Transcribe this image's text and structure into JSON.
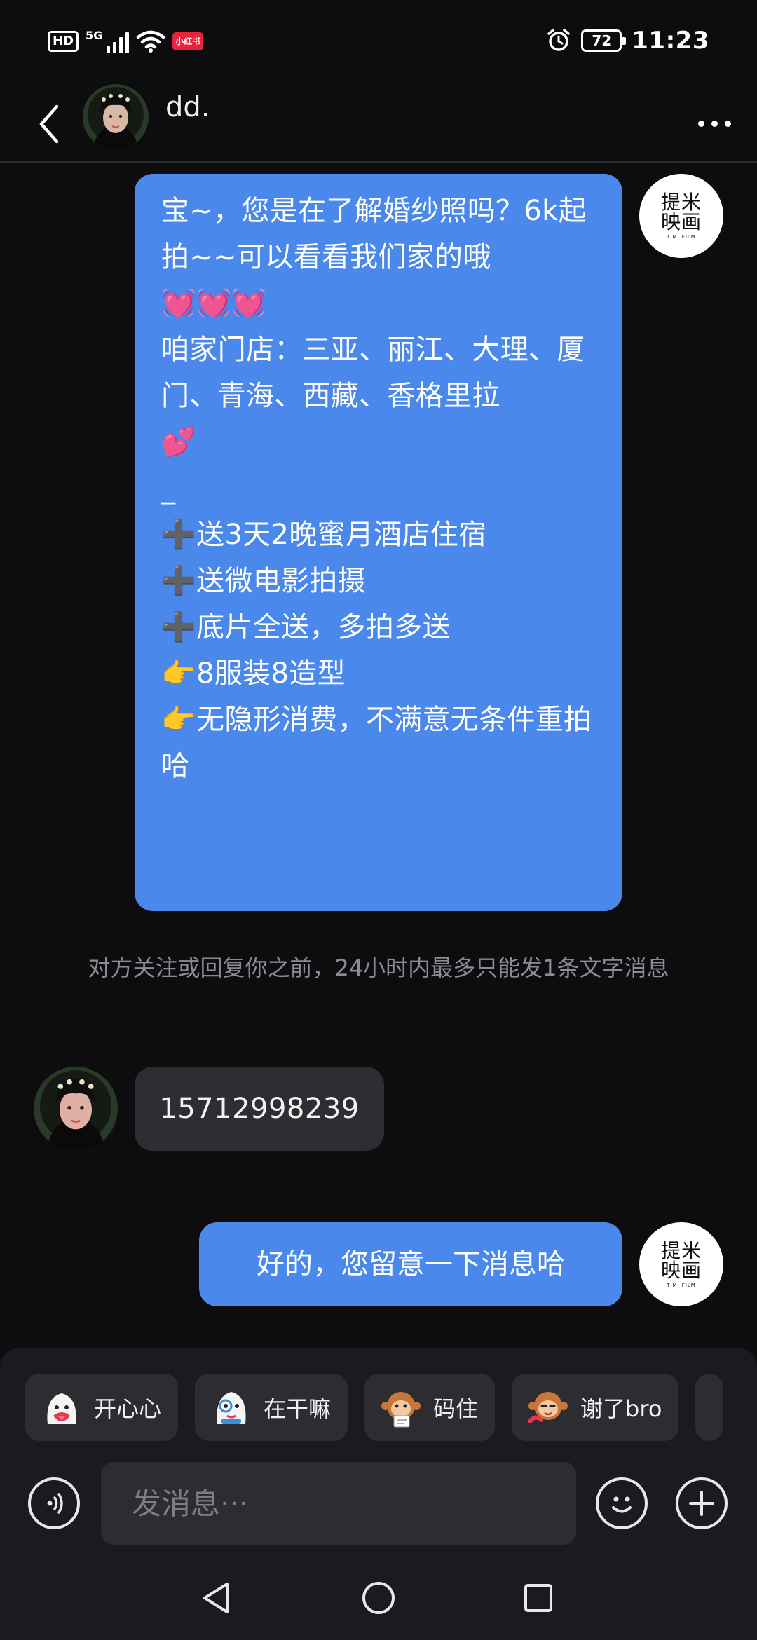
{
  "status_bar": {
    "network_hd": "HD",
    "network_5g": "5G",
    "app_badge": "小红书",
    "battery": "72",
    "time": "11:23"
  },
  "header": {
    "contact_name": "dd.",
    "back_icon": "chevron-left-icon",
    "more_icon": "more-horizontal-icon"
  },
  "brand_avatar": {
    "line1": "提米",
    "line2": "映画",
    "line3": "TIMI FILM"
  },
  "messages": [
    {
      "direction": "outgoing",
      "text": "宝~，您是在了解婚纱照吗？6k起拍~~可以看看我们家的哦\n💓💓💓\n咱家门店：三亚、丽江、大理、厦门、青海、西藏、香格里拉\n💕\n_\n➕送3天2晚蜜月酒店住宿\n➕送微电影拍摄\n➕底片全送，多拍多送\n👉8服装8造型\n👉无隐形消费，不满意无条件重拍哈"
    },
    {
      "direction": "system",
      "text": "对方关注或回复你之前，24小时内最多只能发1条文字消息"
    },
    {
      "direction": "incoming",
      "text": "15712998239"
    },
    {
      "direction": "outgoing",
      "text": "好的，您留意一下消息哈"
    }
  ],
  "quick_replies": [
    {
      "label": "开心心",
      "icon": "happy-ghost-sticker-icon"
    },
    {
      "label": "在干嘛",
      "icon": "curious-ghost-sticker-icon"
    },
    {
      "label": "码住",
      "icon": "monkey-note-sticker-icon"
    },
    {
      "label": "谢了bro",
      "icon": "monkey-thanks-sticker-icon"
    }
  ],
  "input": {
    "placeholder": "发消息···",
    "voice_icon": "voice-icon",
    "emoji_icon": "smiley-icon",
    "plus_icon": "plus-icon"
  },
  "nav": {
    "back_icon": "triangle-back-icon",
    "home_icon": "circle-home-icon",
    "recents_icon": "square-recents-icon"
  },
  "colors": {
    "background": "#0d0d10",
    "outgoing_bubble": "#4a88eb",
    "incoming_bubble": "#2d2d32",
    "panel": "#1b1b1f"
  }
}
